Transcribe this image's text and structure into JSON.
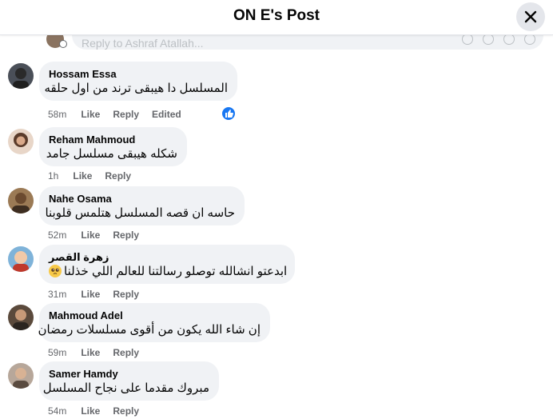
{
  "header": {
    "title": "ON E's Post"
  },
  "reply_box": {
    "placeholder": "Reply to Ashraf Atallah..."
  },
  "comments": [
    {
      "author": "Hossam Essa",
      "text": "المسلسل دا هيبقى ترند من اول حلقه",
      "time": "58m",
      "like": "Like",
      "reply": "Reply",
      "edited": "Edited",
      "avatar_color": "#3b3b3b"
    },
    {
      "author": "Reham Mahmoud",
      "text": "شكله هيبقى مسلسل جامد",
      "time": "1h",
      "like": "Like",
      "reply": "Reply",
      "avatar_color": "#c98b6a"
    },
    {
      "author": "Nahe Osama",
      "text": "حاسه ان قصه المسلسل هتلمس قلوبنا",
      "time": "52m",
      "like": "Like",
      "reply": "Reply",
      "avatar_color": "#7a5a3f"
    },
    {
      "author": "زهرة القصر",
      "text": "ابدعتو انشالله توصلو رسالتنا للعالم اللي خذلنا",
      "time": "31m",
      "like": "Like",
      "reply": "Reply",
      "avatar_color": "#c0392b"
    },
    {
      "author": "Mahmoud Adel",
      "text": "إن شاء الله يكون من أقوى مسلسلات رمضان",
      "time": "59m",
      "like": "Like",
      "reply": "Reply",
      "avatar_color": "#4a3a2e"
    },
    {
      "author": "Samer Hamdy",
      "text": "مبروك مقدما على نجاح المسلسل",
      "time": "54m",
      "like": "Like",
      "reply": "Reply",
      "avatar_color": "#8d6e5a"
    }
  ],
  "icons": {
    "close": "close-icon",
    "like_reaction": "thumbs-up-icon",
    "emoji": "pleading-face-emoji"
  },
  "colors": {
    "bubble": "#f0f2f5",
    "meta": "#65676b",
    "accent": "#1877f2"
  }
}
